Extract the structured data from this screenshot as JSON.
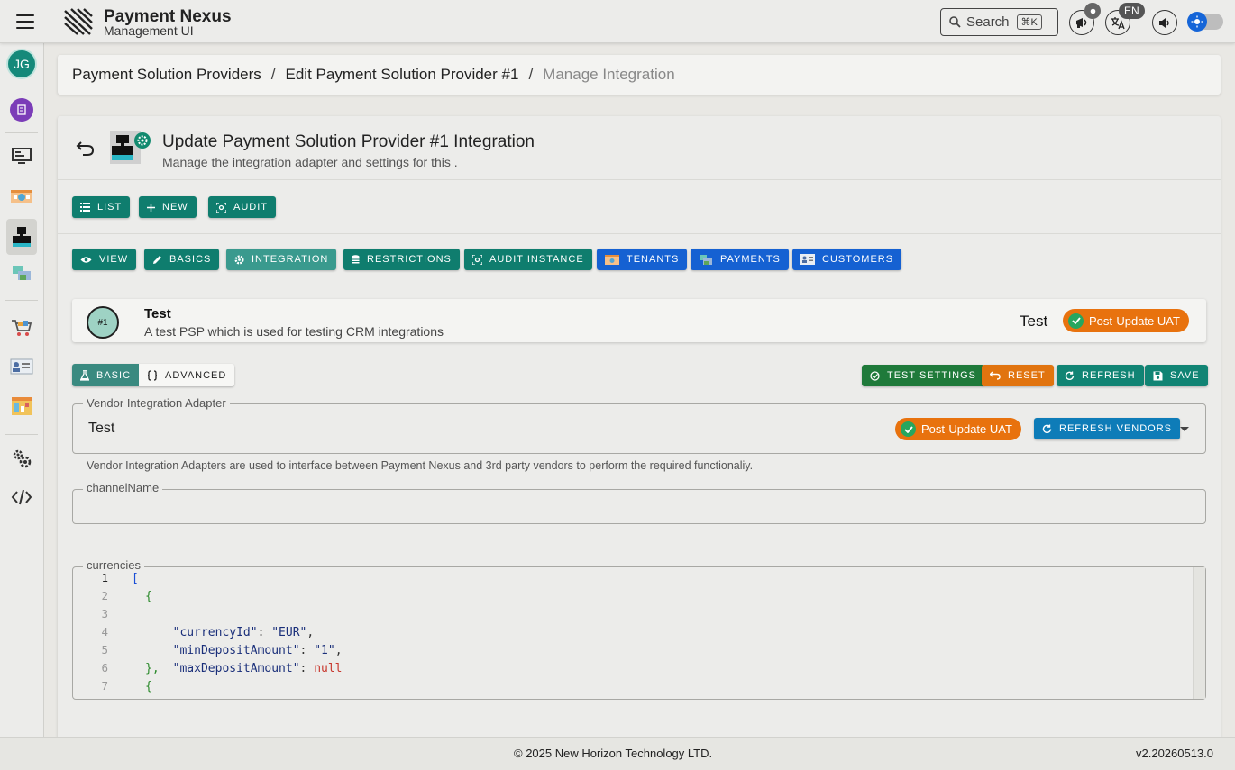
{
  "app": {
    "title": "Payment Nexus",
    "subtitle": "Management UI"
  },
  "topbar": {
    "search_label": "Search",
    "search_shortcut": "⌘K",
    "notification_count": "",
    "language": "EN"
  },
  "sidebar": {
    "avatar_initials": "JG",
    "items": [
      {
        "icon": "monitor-icon"
      },
      {
        "icon": "tenants-icon"
      },
      {
        "icon": "psp-icon",
        "active": true
      },
      {
        "icon": "payments-icon"
      },
      {
        "icon": "cart-icon"
      },
      {
        "icon": "customers-icon"
      },
      {
        "icon": "reports-icon"
      },
      {
        "icon": "settings-icon"
      },
      {
        "icon": "code-icon"
      }
    ]
  },
  "breadcrumb": {
    "items": [
      "Payment Solution Providers",
      "Edit Payment Solution Provider #1",
      "Manage Integration"
    ],
    "separator": "/"
  },
  "header": {
    "title": "Update Payment Solution Provider #1 Integration",
    "subtitle": "Manage the integration adapter and settings for this ."
  },
  "actions": {
    "list": "List",
    "new": "New",
    "audit": "Audit"
  },
  "tabs": {
    "view": "View",
    "basics": "Basics",
    "integration": "Integration",
    "restrictions": "Restrictions",
    "audit_instance": "Audit Instance",
    "tenants": "Tenants",
    "payments": "Payments",
    "customers": "Customers"
  },
  "psp": {
    "number": "#1",
    "name": "Test",
    "description": "A test PSP which is used for testing CRM integrations",
    "environment": "Test",
    "status": "Post-Update UAT"
  },
  "mode": {
    "basic": "Basic",
    "advanced": "Advanced"
  },
  "form_actions": {
    "test_settings": "Test Settings",
    "reset": "Reset",
    "refresh": "Refresh",
    "save": "Save"
  },
  "vendor": {
    "label": "Vendor Integration Adapter",
    "value": "Test",
    "status": "Post-Update UAT",
    "refresh_button": "Refresh Vendors",
    "helper": "Vendor Integration Adapters are used to interface between Payment Nexus and 3rd party vendors to perform the required functionaliy."
  },
  "channel": {
    "label": "channelName",
    "value": ""
  },
  "currencies": {
    "label": "currencies",
    "line_numbers": [
      "1",
      "2",
      "3",
      "4",
      "5",
      "6",
      "7"
    ],
    "lines": {
      "l1": "[",
      "l2": "{",
      "l3_key": "\"currencyId\"",
      "l3_val": "\"EUR\"",
      "l4_key": "\"minDepositAmount\"",
      "l4_val": "\"1\"",
      "l5_key": "\"maxDepositAmount\"",
      "l5_val": "null",
      "l6": "},",
      "l7": "{"
    }
  },
  "footer": {
    "copyright": "© 2025 New Horizon Technology LTD.",
    "version": "v2.20260513.0"
  },
  "colors": {
    "primary_teal": "#0f7d6e",
    "accent_blue": "#1561d2",
    "status_orange": "#e1740f",
    "success_green": "#1f7a3a"
  }
}
